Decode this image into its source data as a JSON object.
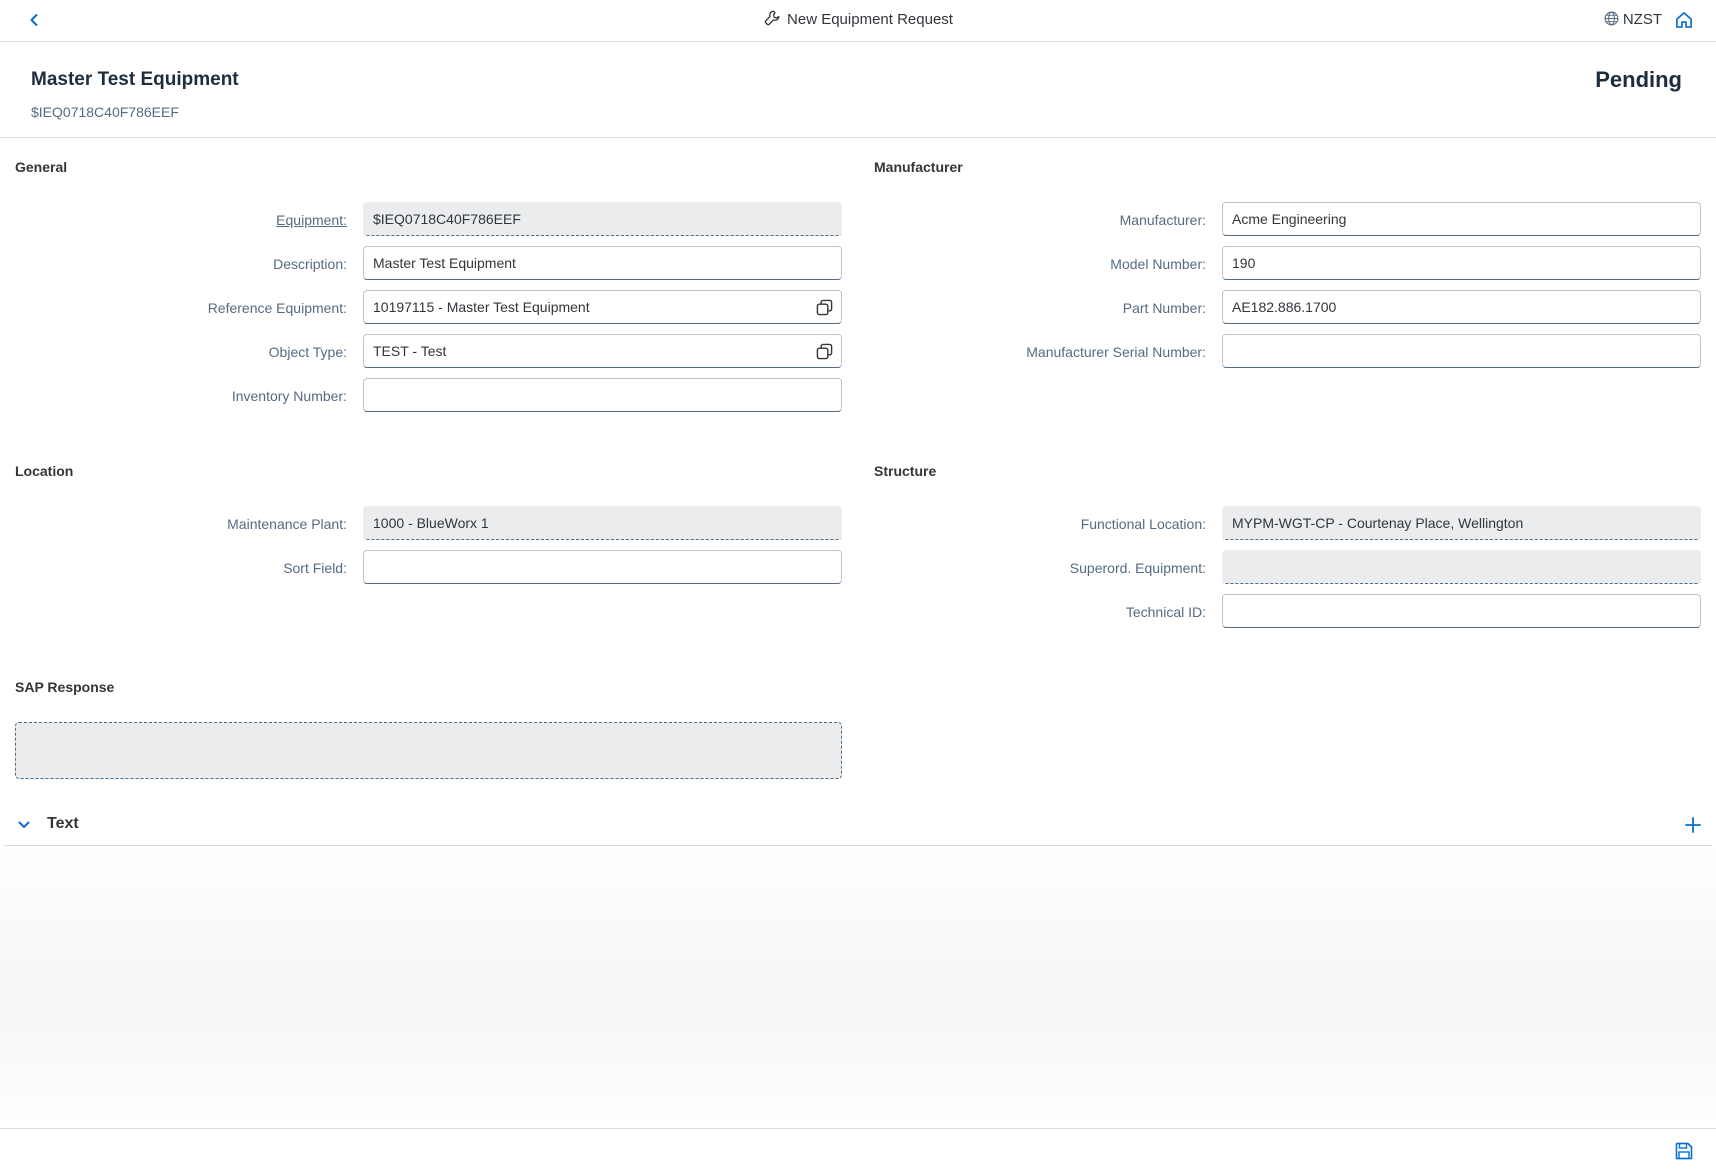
{
  "shell": {
    "title": "New Equipment Request",
    "title_icon": "wrench-icon",
    "timezone": "NZST"
  },
  "header": {
    "title": "Master Test Equipment",
    "subtitle": "$IEQ0718C40F786EEF",
    "status": "Pending"
  },
  "general": {
    "title": "General",
    "fields": [
      {
        "label": "Equipment:",
        "value": "$IEQ0718C40F786EEF"
      },
      {
        "label": "Description:",
        "value": "Master Test Equipment"
      },
      {
        "label": "Reference Equipment:",
        "value": "10197115 - Master Test Equipment"
      },
      {
        "label": "Object Type:",
        "value": "TEST - Test"
      },
      {
        "label": "Inventory Number:",
        "value": ""
      }
    ]
  },
  "manufacturer": {
    "title": "Manufacturer",
    "fields": [
      {
        "label": "Manufacturer:",
        "value": "Acme Engineering"
      },
      {
        "label": "Model Number:",
        "value": "190"
      },
      {
        "label": "Part Number:",
        "value": "AE182.886.1700"
      },
      {
        "label": "Manufacturer Serial Number:",
        "value": ""
      }
    ]
  },
  "location": {
    "title": "Location",
    "fields": [
      {
        "label": "Maintenance Plant:",
        "value": "1000 - BlueWorx 1"
      },
      {
        "label": "Sort Field:",
        "value": ""
      }
    ]
  },
  "structure": {
    "title": "Structure",
    "fields": [
      {
        "label": "Functional Location:",
        "value": "MYPM-WGT-CP - Courtenay Place, Wellington"
      },
      {
        "label": "Superord. Equipment:",
        "value": ""
      },
      {
        "label": "Technical ID:",
        "value": ""
      }
    ]
  },
  "sap_response": {
    "title": "SAP Response",
    "value": ""
  },
  "text_panel": {
    "title": "Text"
  },
  "colors": {
    "accent": "#0a6ed1",
    "label": "#556b82",
    "readonly_bg": "#eaecee"
  }
}
